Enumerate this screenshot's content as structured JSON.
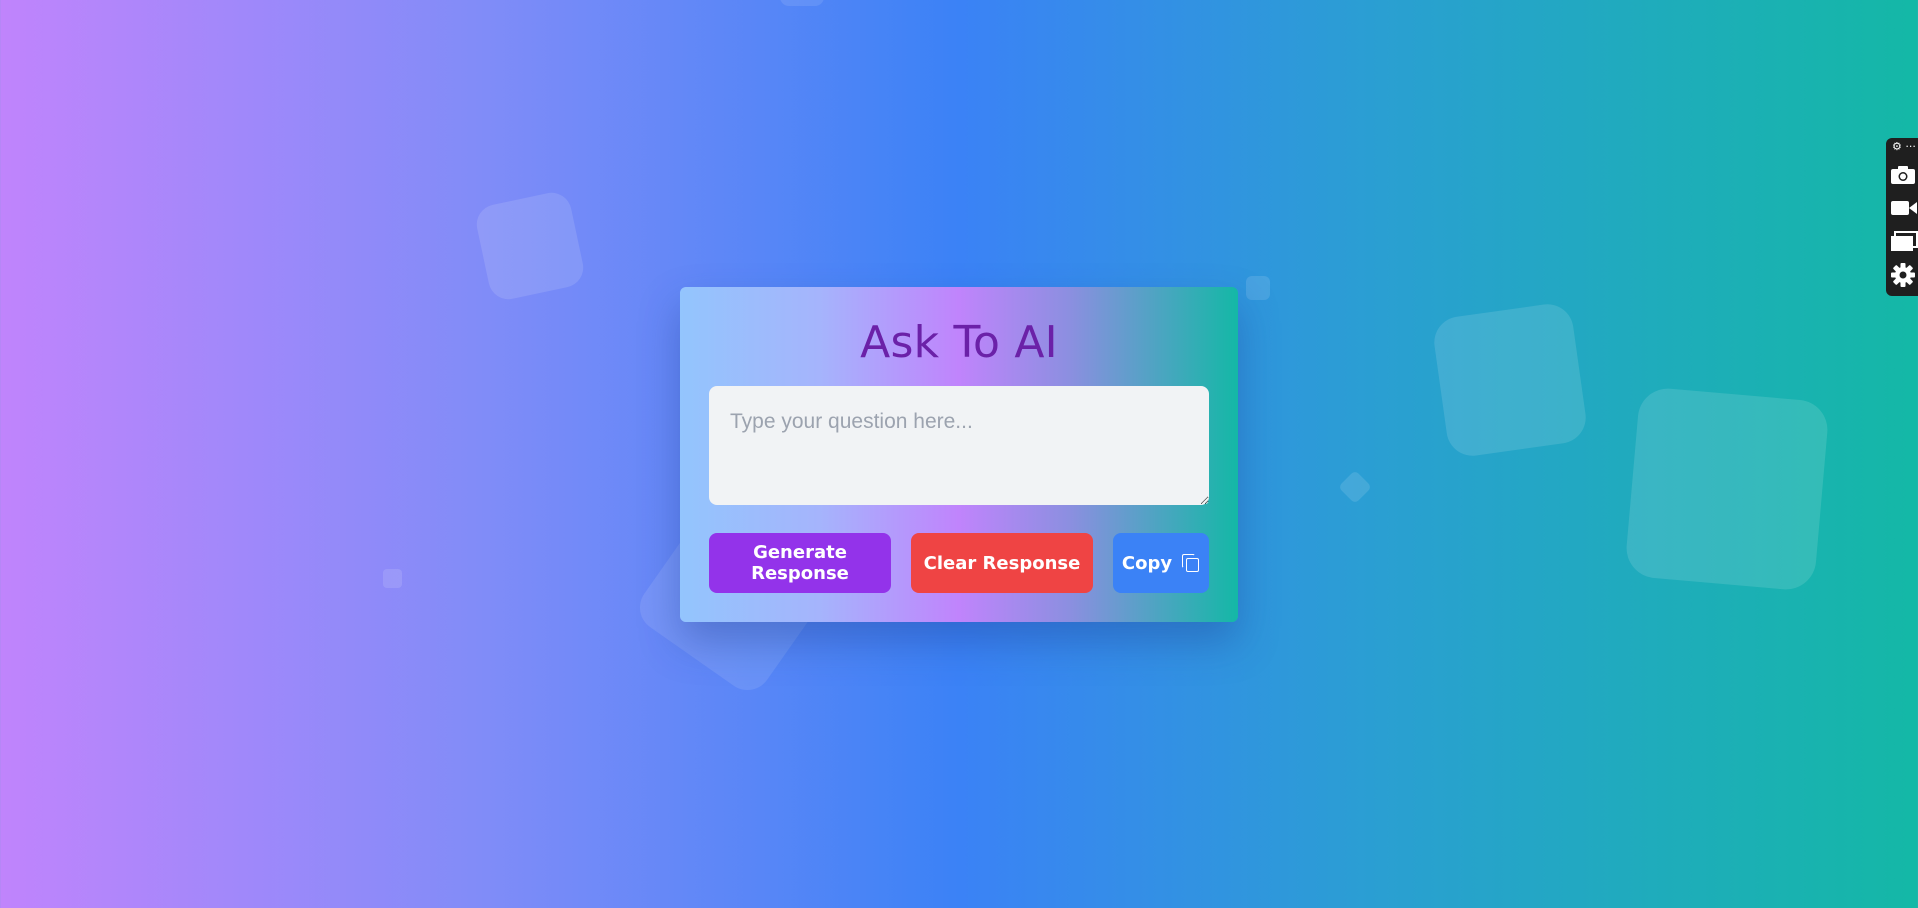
{
  "card": {
    "title": "Ask To AI",
    "question_placeholder": "Type your question here...",
    "question_value": ""
  },
  "buttons": {
    "generate_label": "Generate Response",
    "clear_label": "Clear Response",
    "copy_label": "Copy"
  },
  "toolbar": {
    "top_label": "⚙ ···",
    "items": [
      "camera-icon",
      "video-icon",
      "window-icon",
      "gear-icon"
    ]
  },
  "colors": {
    "title": "#6b21a8",
    "generate": "#9333ea",
    "clear": "#ef4444",
    "copy": "#3b82f6"
  }
}
